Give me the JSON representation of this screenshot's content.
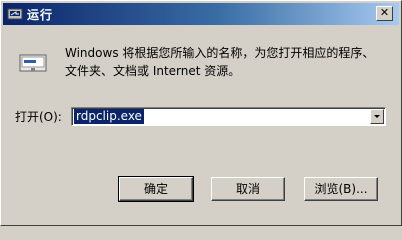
{
  "window": {
    "title": "运行",
    "close_glyph": "✕"
  },
  "dialog": {
    "description": "Windows 将根据您所输入的名称，为您打开相应的程序、文件夹、文档或 Internet 资源。",
    "open_label": "打开(O):",
    "open_value": "rdpclip.exe"
  },
  "buttons": {
    "ok": "确定",
    "cancel": "取消",
    "browse": "浏览(B)..."
  },
  "icons": {
    "title": "run-icon",
    "main": "run-icon",
    "dropdown": "chevron-down-icon"
  },
  "colors": {
    "titlebar_start": "#0a246a",
    "titlebar_end": "#a6caf0",
    "selection": "#0a246a",
    "face": "#d4d0c8"
  }
}
